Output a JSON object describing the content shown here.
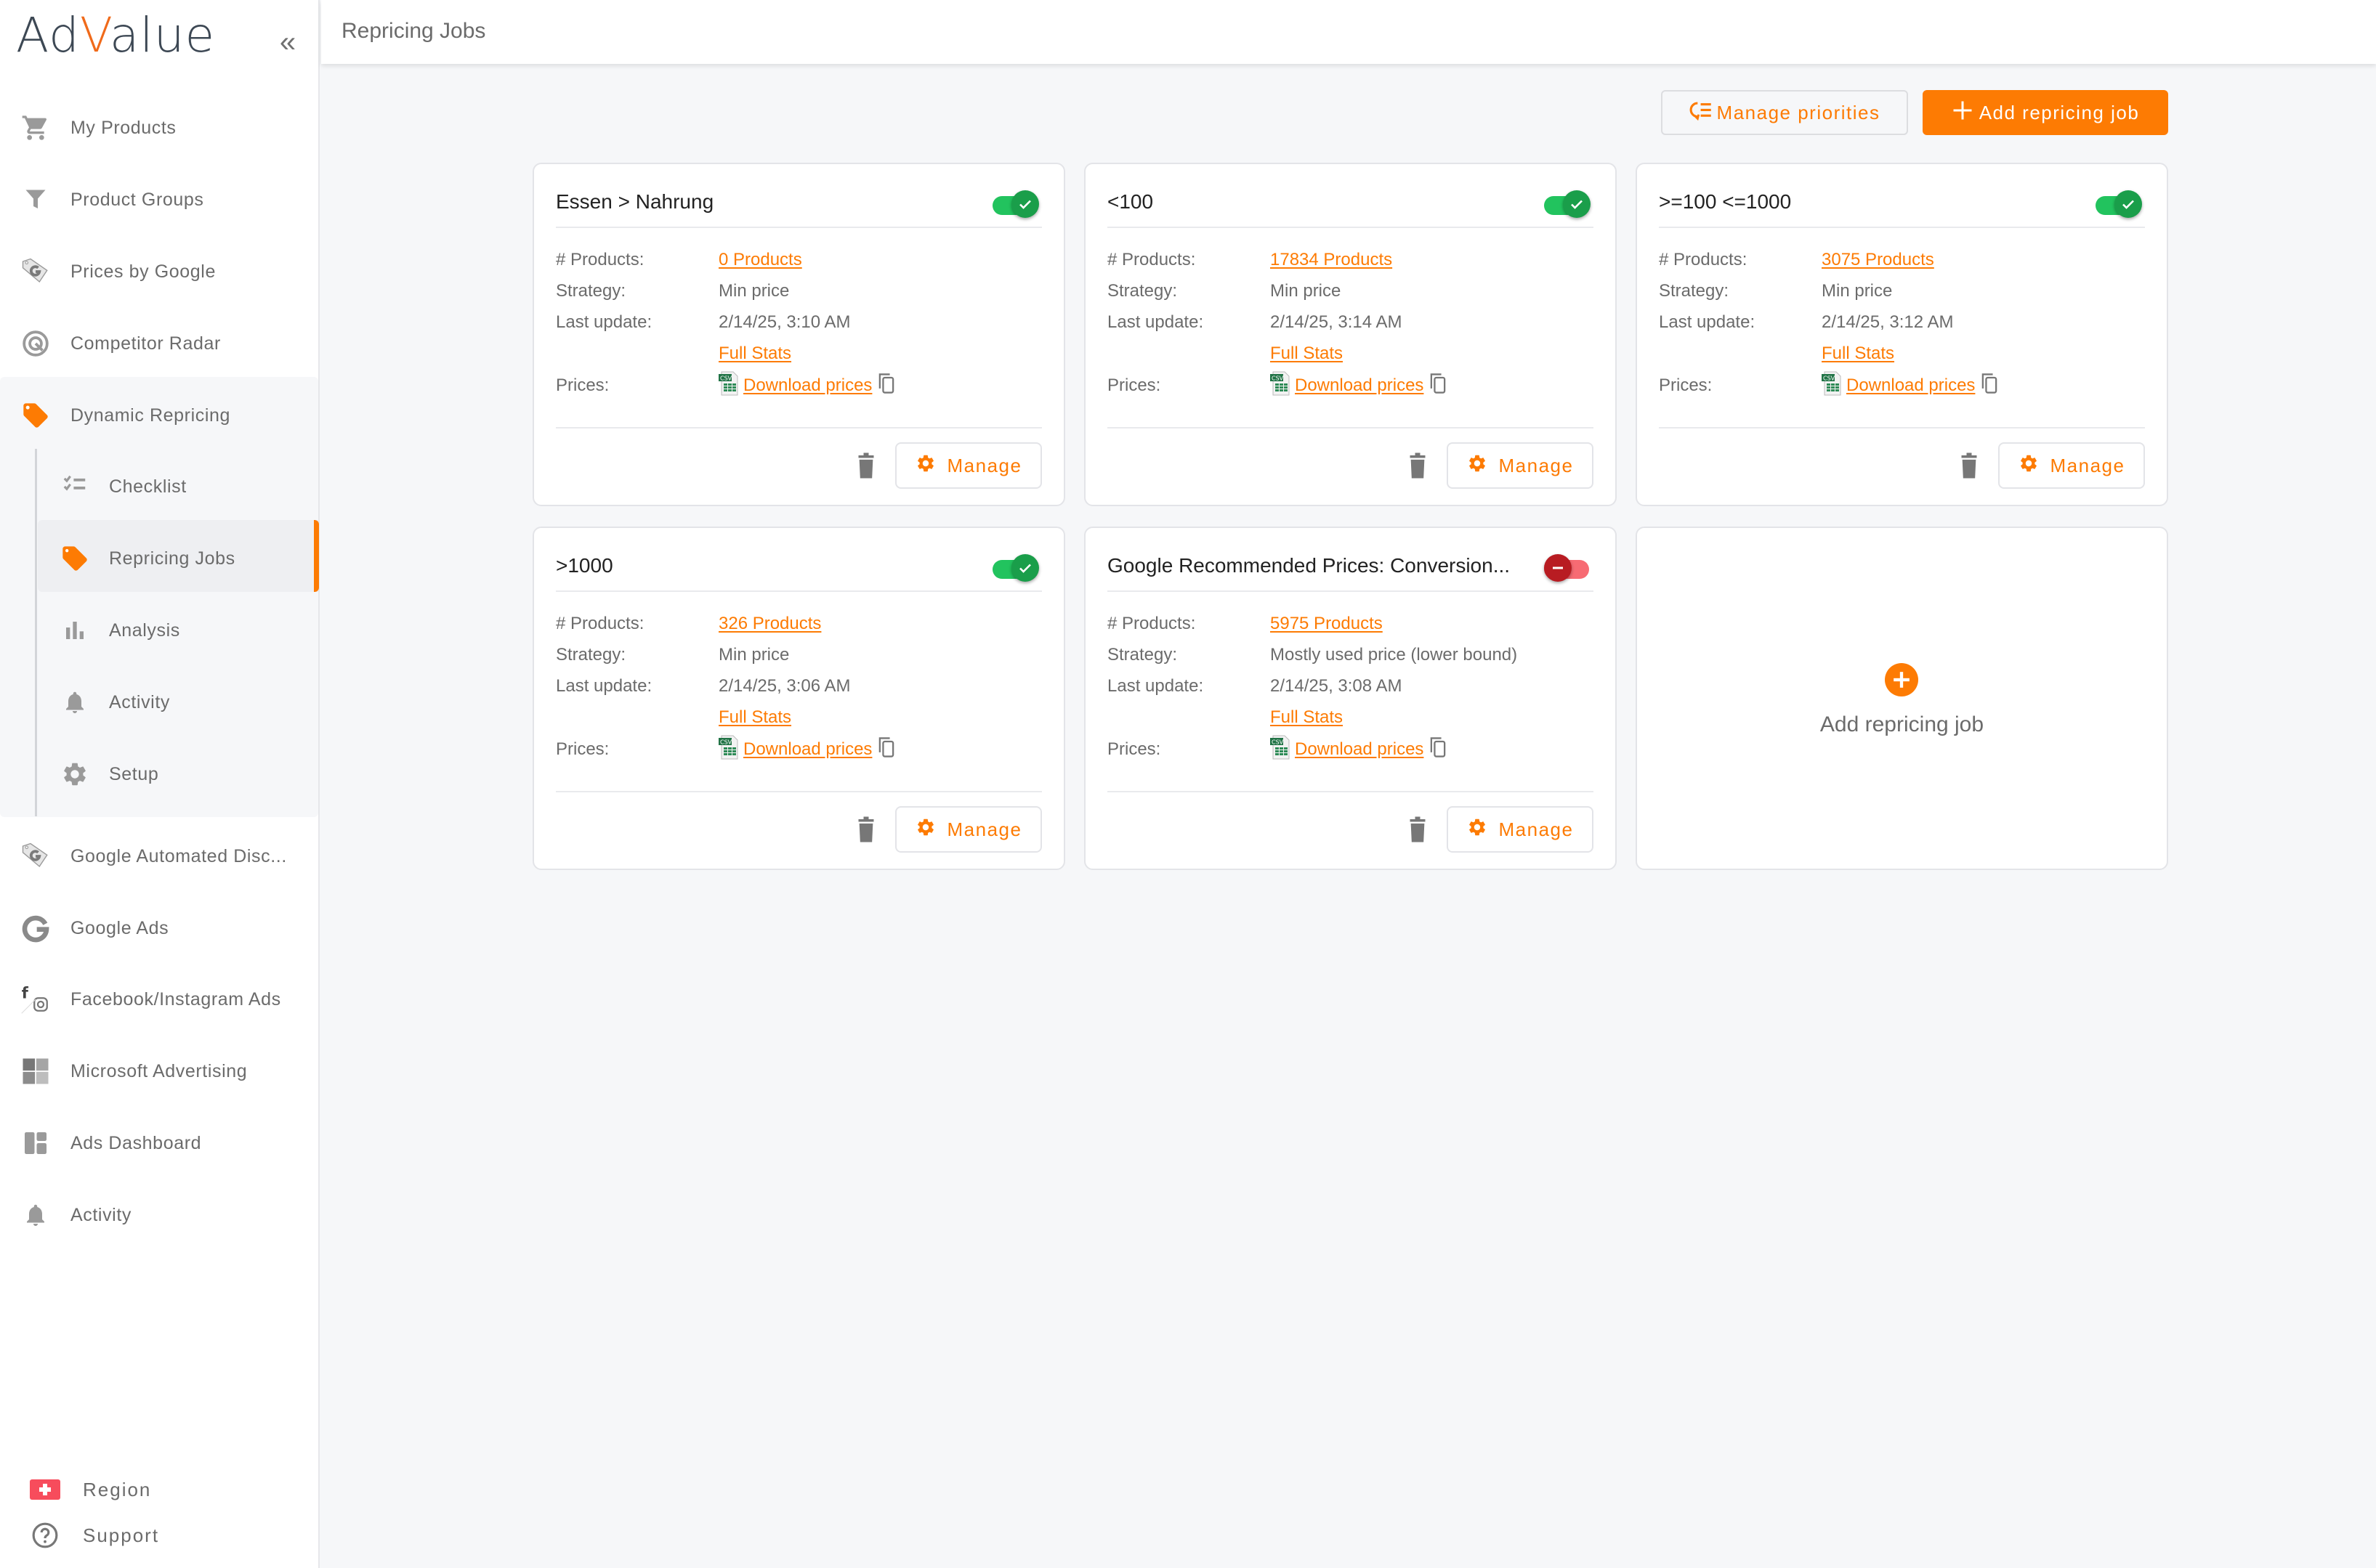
{
  "app": {
    "logo_prefix": "Ad",
    "logo_accent": "V",
    "logo_suffix": "alue",
    "collapse_label": "«"
  },
  "header": {
    "title": "Repricing Jobs"
  },
  "colors": {
    "accent": "#fd7b03",
    "toggle_on": "#22c35e",
    "toggle_off": "#f76b73",
    "text_muted": "#6b6b6b"
  },
  "sidebar": {
    "items": [
      {
        "label": "My Products",
        "icon": "cart-icon"
      },
      {
        "label": "Product Groups",
        "icon": "filter-icon"
      },
      {
        "label": "Prices by Google",
        "icon": "google-tag-icon"
      },
      {
        "label": "Competitor Radar",
        "icon": "radar-icon"
      },
      {
        "label": "Dynamic Repricing",
        "icon": "price-tag-icon"
      }
    ],
    "subitems": [
      {
        "label": "Checklist",
        "icon": "checklist-icon"
      },
      {
        "label": "Repricing Jobs",
        "icon": "price-tag-icon",
        "active": true
      },
      {
        "label": "Analysis",
        "icon": "bar-chart-icon"
      },
      {
        "label": "Activity",
        "icon": "bell-icon"
      },
      {
        "label": "Setup",
        "icon": "gear-icon"
      }
    ],
    "lower_items": [
      {
        "label": "Google Automated Disc...",
        "icon": "google-tag-icon"
      },
      {
        "label": "Google Ads",
        "icon": "google-icon"
      },
      {
        "label": "Facebook/Instagram Ads",
        "icon": "facebook-instagram-icon"
      },
      {
        "label": "Microsoft Advertising",
        "icon": "microsoft-icon"
      },
      {
        "label": "Ads Dashboard",
        "icon": "dashboard-icon"
      },
      {
        "label": "Activity",
        "icon": "bell-icon"
      }
    ],
    "bottom": [
      {
        "label": "Region",
        "icon": "swiss-flag-icon"
      },
      {
        "label": "Support",
        "icon": "help-icon"
      }
    ]
  },
  "toolbar": {
    "manage_priorities_label": "Manage priorities",
    "add_job_label": "Add repricing job"
  },
  "labels": {
    "products": "# Products:",
    "strategy": "Strategy:",
    "last_update": "Last update:",
    "prices": "Prices:",
    "full_stats": "Full Stats",
    "download_prices": "Download prices",
    "manage": "Manage",
    "csv_badge": "CSV"
  },
  "jobs": [
    {
      "title": "Essen > Nahrung",
      "enabled": true,
      "products": "0 Products",
      "strategy": "Min price",
      "last_update": "2/14/25, 3:10 AM"
    },
    {
      "title": "<100",
      "enabled": true,
      "products": "17834 Products",
      "strategy": "Min price",
      "last_update": "2/14/25, 3:14 AM"
    },
    {
      "title": ">=100 <=1000",
      "enabled": true,
      "products": "3075 Products",
      "strategy": "Min price",
      "last_update": "2/14/25, 3:12 AM"
    },
    {
      "title": ">1000",
      "enabled": true,
      "products": "326 Products",
      "strategy": "Min price",
      "last_update": "2/14/25, 3:06 AM"
    },
    {
      "title": "Google Recommended Prices: Conversion...",
      "enabled": false,
      "products": "5975 Products",
      "strategy": "Mostly used price (lower bound)",
      "last_update": "2/14/25, 3:08 AM"
    }
  ],
  "add_card": {
    "label": "Add repricing job"
  }
}
